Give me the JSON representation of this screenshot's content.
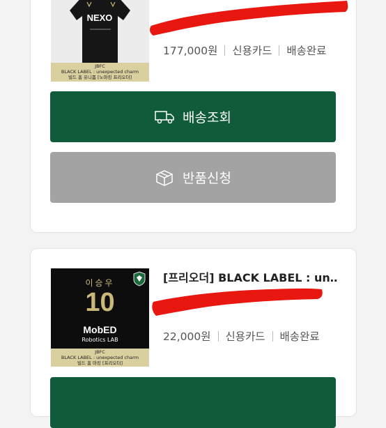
{
  "orders": [
    {
      "thumb": {
        "jersey_text": "NEXO",
        "caption": [
          "JBFC",
          "BLACK LABEL : unexpected charm",
          "빌드 홈 유니폼 [노마킹 프리오더]"
        ]
      },
      "title": "",
      "price": "177,000원",
      "payment": "신용카드",
      "status": "배송완료",
      "buttons": {
        "ship": "배송조회",
        "return": "반품신청"
      }
    },
    {
      "thumb": {
        "player_name": "이승우",
        "number": "10",
        "sponsor": "MobED",
        "sponsor_sub": "Robotics LAB",
        "caption": [
          "JBFC",
          "BLACK LABEL : unexpected charm",
          "빌드 홈 마킹 [프리오더]"
        ]
      },
      "title": "[프리오더] BLACK LABEL : un…",
      "price": "22,000원",
      "payment": "신용카드",
      "status": "배송완료",
      "buttons": {
        "ship": ""
      }
    }
  ],
  "colors": {
    "primary": "#0f5b3a",
    "disabled": "#a3a3a3",
    "redaction": "#e8170f",
    "caption_bg": "#d9cf9f"
  },
  "icons": {
    "ship": "delivery-truck-icon",
    "return": "return-box-icon",
    "crest": "club-crest-icon"
  }
}
